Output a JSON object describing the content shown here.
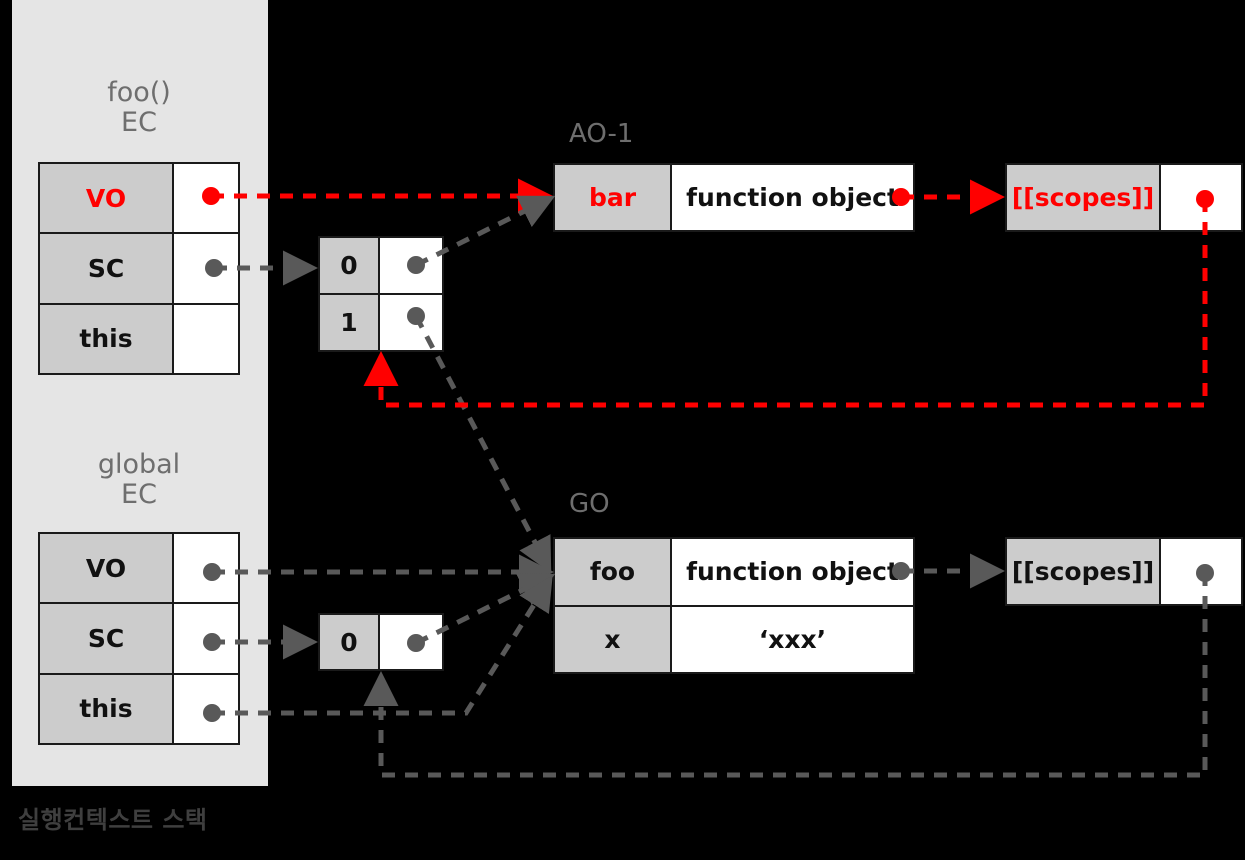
{
  "caption": "실행컨텍스트 스택",
  "groups": {
    "foo_ec": {
      "line1": "foo()",
      "line2": "EC"
    },
    "global_ec": {
      "line1": "global",
      "line2": "EC"
    },
    "ao1": "AO-1",
    "go": "GO"
  },
  "foo_ec_table": {
    "rows": [
      {
        "key": "VO",
        "value": "",
        "key_color": "#ff0000"
      },
      {
        "key": "SC",
        "value": ""
      },
      {
        "key": "this",
        "value": ""
      }
    ]
  },
  "global_ec_table": {
    "rows": [
      {
        "key": "VO",
        "value": ""
      },
      {
        "key": "SC",
        "value": ""
      },
      {
        "key": "this",
        "value": ""
      }
    ]
  },
  "foo_scope_chain": {
    "rows": [
      {
        "index": "0",
        "value": ""
      },
      {
        "index": "1",
        "value": ""
      }
    ]
  },
  "global_scope_chain": {
    "rows": [
      {
        "index": "0",
        "value": ""
      }
    ]
  },
  "ao1_table": {
    "rows": [
      {
        "key": "bar",
        "value": "function object",
        "key_color": "#ff0000"
      }
    ]
  },
  "go_table": {
    "rows": [
      {
        "key": "foo",
        "value": "function object"
      },
      {
        "key": "x",
        "value": "‘xxx’"
      }
    ]
  },
  "scopes_top": {
    "label": "[[scopes]]",
    "value": "",
    "color": "#ff0000"
  },
  "scopes_bottom": {
    "label": "[[scopes]]",
    "value": "",
    "color": "#1a1a1a"
  },
  "colors": {
    "background": "#000000",
    "panel": "#e5e5e5",
    "key_cell": "#cccccc",
    "value_cell": "#ffffff",
    "border": "#1a1a1a",
    "accent_red": "#ff0000",
    "wire_grey": "#595959",
    "title_grey": "#6e6e6e",
    "caption_grey": "#3f3f3f"
  }
}
